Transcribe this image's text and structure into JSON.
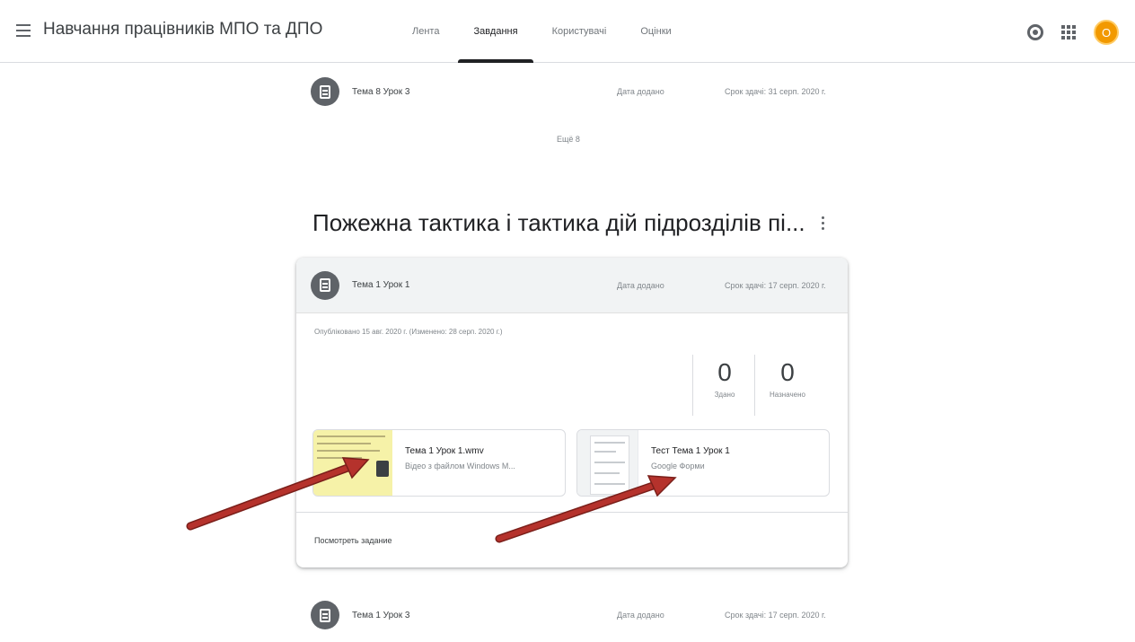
{
  "header": {
    "class_title": "Навчання працівників МПО та ДПО",
    "tabs": [
      {
        "label": "Лента",
        "active": false
      },
      {
        "label": "Завдання",
        "active": true
      },
      {
        "label": "Користувачі",
        "active": false
      },
      {
        "label": "Оцінки",
        "active": false
      }
    ],
    "avatar_letter": "О",
    "avatar_color": "#f29900"
  },
  "assignments_before": [
    {
      "title": "Тема 8 Урок 3",
      "posted": "Дата додано",
      "due": "Срок здачі: 31 серп. 2020 г."
    }
  ],
  "more_label": "Ещё 8",
  "section": {
    "title": "Пожежна тактика і тактика дій підрозділів пі..."
  },
  "expanded_assignment": {
    "title": "Тема 1 Урок 1",
    "posted": "Дата додано",
    "due": "Срок здачі: 17 серп. 2020 г.",
    "meta": "Опубліковано 15 авг. 2020 г. (Изменено: 28 серп. 2020 г.)",
    "stats": [
      {
        "value": "0",
        "label": "Здано"
      },
      {
        "value": "0",
        "label": "Назначено"
      }
    ],
    "attachments": [
      {
        "title": "Тема 1 Урок 1.wmv",
        "subtitle": "Відео з файлом Windows M..."
      },
      {
        "title": "Тест Тема 1 Урок 1",
        "subtitle": "Google Форми"
      }
    ],
    "view_label": "Посмотреть задание"
  },
  "assignments_after": [
    {
      "title": "Тема 1 Урок 3",
      "posted": "Дата додано",
      "due": "Срок здачі: 17 серп. 2020 г."
    }
  ],
  "colors": {
    "arrow": "#b5322c",
    "card_head": "#f1f3f4",
    "video_thumb": "#f6f2a8"
  }
}
